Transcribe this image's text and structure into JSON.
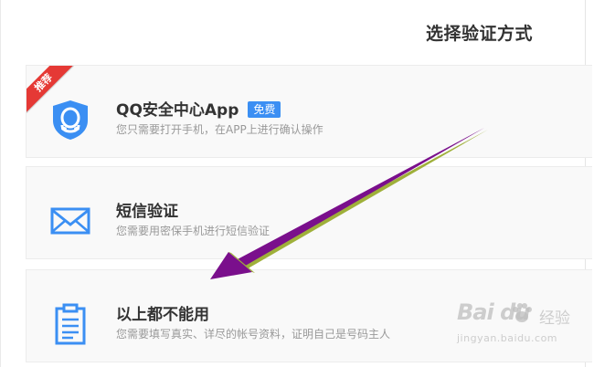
{
  "page": {
    "title": "选择验证方式"
  },
  "options": [
    {
      "name": "QQ安全中心App",
      "badge": "免费",
      "ribbon": "推荐",
      "desc": "您只需要打开手机，在APP上进行确认操作",
      "icon": "qq-shield-icon"
    },
    {
      "name": "短信验证",
      "desc": "您需要用密保手机进行短信验证",
      "icon": "envelope-icon"
    },
    {
      "name": "以上都不能用",
      "desc": "您需要填写真实、详尽的帐号资料，证明自己是号码主人",
      "icon": "clipboard-icon"
    }
  ],
  "watermark": {
    "logo": "Bai du",
    "text": "经验",
    "url": "jingyan.baidu.com"
  },
  "colors": {
    "accent": "#3b8ff3",
    "ribbon": "#e53935",
    "arrow": "#7a0f8c",
    "title": "#333333",
    "desc": "#999999",
    "card_bg": "#f9f9f9"
  }
}
